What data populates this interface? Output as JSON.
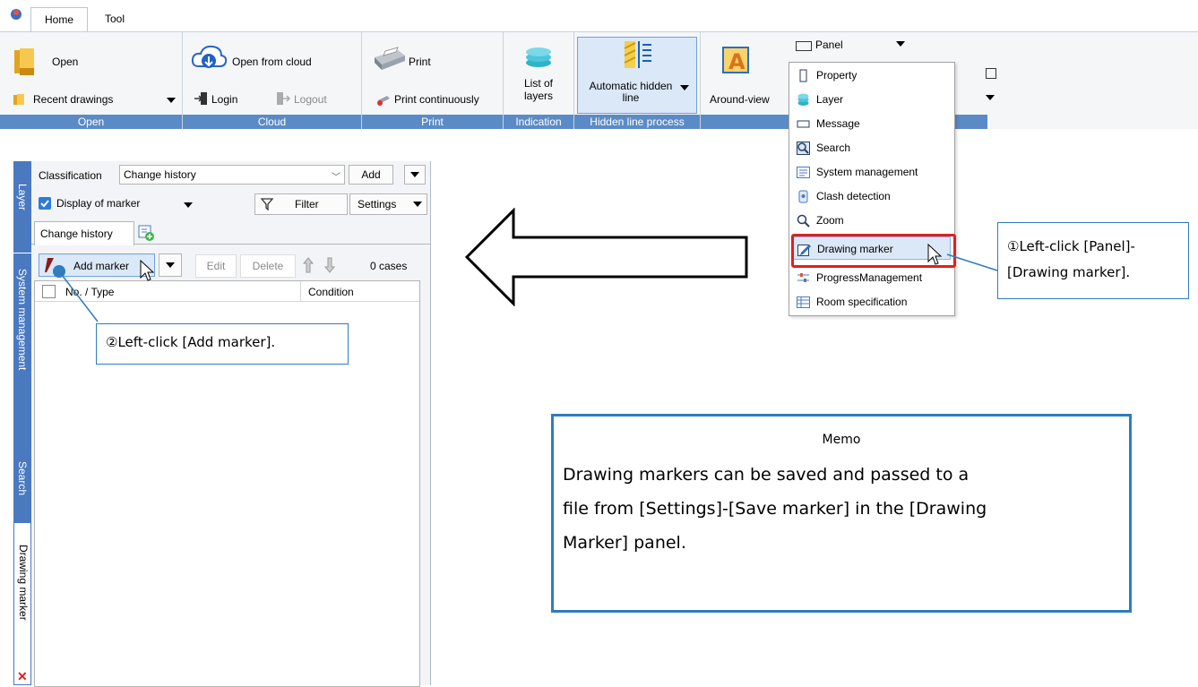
{
  "tabs": {
    "home": "Home",
    "tool": "Tool"
  },
  "ribbon": {
    "open": {
      "open": "Open",
      "recent": "Recent drawings",
      "group": "Open"
    },
    "cloud": {
      "open_cloud": "Open from cloud",
      "login": "Login",
      "logout": "Logout",
      "group": "Cloud"
    },
    "print": {
      "print": "Print",
      "print_cont": "Print continuously",
      "group": "Print"
    },
    "indication": {
      "list_of": "List of",
      "layers": "layers",
      "group": "Indication"
    },
    "hidden": {
      "line1": "Automatic hidden",
      "line2": "line",
      "group": "Hidden line process"
    },
    "around": {
      "label": "Around-view"
    },
    "panel": {
      "label": "Panel"
    }
  },
  "menu": {
    "items": [
      "Property",
      "Layer",
      "Message",
      "Search",
      "System management",
      "Clash detection",
      "Zoom",
      "Drawing marker",
      "ProgressManagement",
      "Room specification"
    ]
  },
  "side_tabs": {
    "layer": "Layer",
    "system": "System management",
    "search": "Search",
    "drawing_marker": "Drawing marker"
  },
  "panel": {
    "classification_label": "Classification",
    "classification_value": "Change history",
    "add": "Add",
    "display_marker": "Display of marker",
    "filter": "Filter",
    "settings": "Settings",
    "tab_change_history": "Change history",
    "add_marker": "Add marker",
    "edit": "Edit",
    "delete": "Delete",
    "count": "0 cases",
    "col_no_type": "No. / Type",
    "col_condition": "Condition"
  },
  "callouts": {
    "step1_line1": "①Left-click [Panel]-",
    "step1_line2": "[Drawing marker].",
    "step2": "②Left-click [Add marker].",
    "memo_title": "Memo",
    "memo_l1": "Drawing markers can be saved and passed to a",
    "memo_l2": "file from [Settings]-[Save marker] in the [Drawing",
    "memo_l3": "Marker] panel."
  },
  "colors": {
    "accent": "#2f7cbf",
    "group_label": "#5b8bc6",
    "highlight": "#e02020",
    "sidebar": "#4a79c0"
  }
}
